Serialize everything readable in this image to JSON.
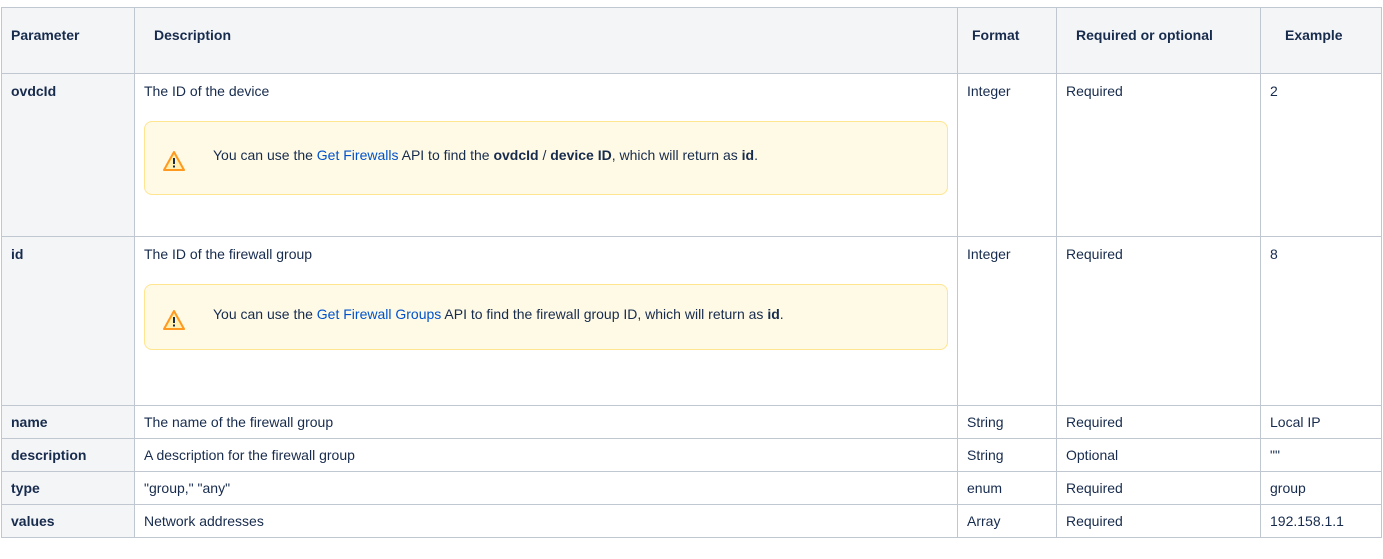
{
  "headers": {
    "parameter": "Parameter",
    "description": "Description",
    "format": "Format",
    "required": "Required or optional",
    "example": "Example"
  },
  "rows": [
    {
      "param": "ovdcId",
      "description": "The ID of the device",
      "format": "Integer",
      "required": "Required",
      "example": "2",
      "note": {
        "icon": "warning-icon",
        "prefix": "You can use the ",
        "link": "Get Firewalls",
        "mid1": " API to find the ",
        "bold1": "ovdcId",
        "mid2": " / ",
        "bold2": "device ID",
        "mid3": ", which will return as ",
        "bold3": "id",
        "suffix": "."
      }
    },
    {
      "param": "id",
      "description": "The ID of the firewall group",
      "format": "Integer",
      "required": "Required",
      "example": "8",
      "note": {
        "icon": "warning-icon",
        "prefix": "You can use the ",
        "link": "Get Firewall Groups",
        "mid1": " API to find the firewall group ID, which will return as ",
        "bold1": "id",
        "suffix": "."
      }
    },
    {
      "param": "name",
      "description": "The name of the firewall group",
      "format": "String",
      "required": "Required",
      "example": "Local IP"
    },
    {
      "param": "description",
      "description": "A description for the firewall group",
      "format": "String",
      "required": "Optional",
      "example": "\"\""
    },
    {
      "param": "type",
      "description": "\"group,\" \"any\"",
      "format": "enum",
      "required": "Required",
      "example": "group"
    },
    {
      "param": "values",
      "description": "Network addresses",
      "format": "Array",
      "required": "Required",
      "example": "192.158.1.1"
    }
  ],
  "colors": {
    "header_bg": "#f4f5f7",
    "border": "#c1c7d0",
    "link": "#0052cc",
    "note_bg": "#fffae6",
    "note_border": "#ffe58f",
    "warning": "#ff991f"
  }
}
